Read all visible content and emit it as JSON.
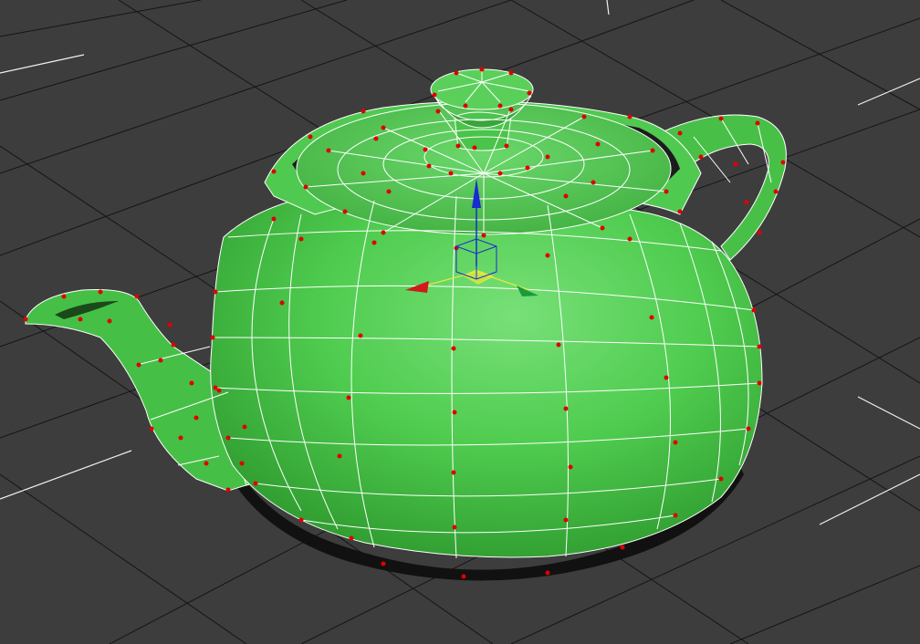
{
  "viewport": {
    "background_color": "#3d3d3d",
    "grid_color": "#111111",
    "grid_accent_color": "#f0f0f0"
  },
  "object": {
    "name": "teapot",
    "mesh_color": "#4cc94c",
    "wire_color": "#ffffff",
    "vertex_color": "#e00000",
    "edge_shadow_color": "#0a0a0a"
  },
  "gizmo": {
    "axes": [
      "x",
      "y",
      "z"
    ],
    "x_color": "#d11a1a",
    "y_color": "#1a9a3a",
    "z_color": "#1a2bd1",
    "plane_color": "#e8e83a",
    "icons": [
      "move-gizmo-icon"
    ]
  }
}
